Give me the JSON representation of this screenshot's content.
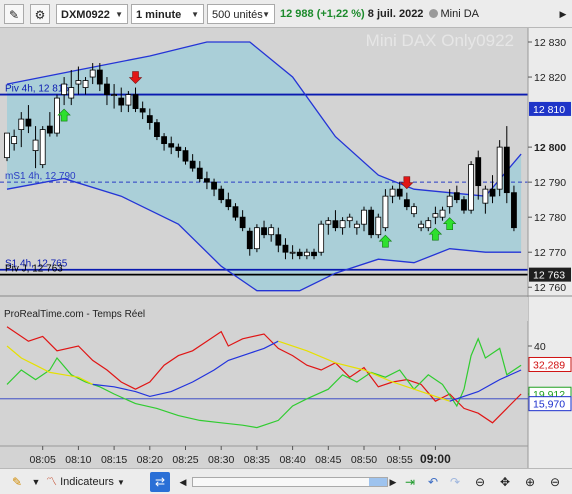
{
  "toolbar": {
    "instrument": "DXM0922",
    "timeframe": "1 minute",
    "units": "500 unités",
    "last_price": "12 988",
    "change": "(+1,22 %)",
    "date": "8 juil. 2022",
    "market_name": "Mini DA"
  },
  "chart": {
    "watermark": "Mini DAX Only0922",
    "y_ticks": [
      {
        "label": "12 830",
        "bold": false
      },
      {
        "label": "12 820",
        "bold": false
      },
      {
        "label": "12 800",
        "bold": true
      },
      {
        "label": "12 790",
        "bold": false
      },
      {
        "label": "12 780",
        "bold": false
      },
      {
        "label": "12 770",
        "bold": false
      },
      {
        "label": "12 760",
        "bold": false
      }
    ],
    "price_tags": [
      {
        "label": "12 810",
        "value": 12810.9,
        "bg": "#1f35c8",
        "fg": "#ffffff"
      },
      {
        "label": "12 763",
        "value": 12763.6,
        "bg": "#1f1f1f",
        "fg": "#ffffff"
      }
    ],
    "levels": [
      {
        "label": "Piv 4h, 12 815",
        "value": 12815,
        "color": "#0a1ab0",
        "style": "solid"
      },
      {
        "label": "mS1 4h, 12 790",
        "value": 12790,
        "color": "#2a3cc4",
        "style": "dashed"
      },
      {
        "label": "S1 4h, 12 765",
        "value": 12765,
        "color": "#0a1ab0",
        "style": "solid"
      },
      {
        "label": "Piv J, 12 763",
        "value": 12763.6,
        "color": "#000000",
        "style": "solid"
      }
    ],
    "candles": [
      [
        12797,
        12804,
        12796,
        12804
      ],
      [
        12801,
        12805,
        12799,
        12803
      ],
      [
        12805,
        12810,
        12800,
        12808
      ],
      [
        12808,
        12812,
        12804,
        12806
      ],
      [
        12799,
        12806,
        12794,
        12802
      ],
      [
        12795,
        12806,
        12794,
        12805
      ],
      [
        12806,
        12810,
        12803,
        12804
      ],
      [
        12804,
        12815,
        12803,
        12814
      ],
      [
        12815,
        12820,
        12812,
        12818
      ],
      [
        12814,
        12822,
        12812,
        12817
      ],
      [
        12818,
        12823,
        12815,
        12819
      ],
      [
        12817,
        12820,
        12815,
        12819
      ],
      [
        12820,
        12824,
        12818,
        12822
      ],
      [
        12822,
        12824,
        12816,
        12818
      ],
      [
        12818,
        12820,
        12812,
        12815
      ],
      [
        12815,
        12818,
        12811,
        12815
      ],
      [
        12814,
        12817,
        12810,
        12812
      ],
      [
        12812,
        12816,
        12810,
        12815
      ],
      [
        12815,
        12817,
        12810,
        12811
      ],
      [
        12811,
        12813,
        12808,
        12810
      ],
      [
        12809,
        12811,
        12805,
        12807
      ],
      [
        12807,
        12808,
        12802,
        12803
      ],
      [
        12803,
        12804,
        12799,
        12801
      ],
      [
        12801,
        12803,
        12798,
        12800
      ],
      [
        12800,
        12801,
        12797,
        12799
      ],
      [
        12799,
        12800,
        12795,
        12796
      ],
      [
        12796,
        12798,
        12793,
        12794
      ],
      [
        12794,
        12796,
        12790,
        12791
      ],
      [
        12791,
        12793,
        12788,
        12790
      ],
      [
        12790,
        12791,
        12786,
        12788
      ],
      [
        12788,
        12789,
        12784,
        12785
      ],
      [
        12785,
        12787,
        12782,
        12783
      ],
      [
        12783,
        12784,
        12779,
        12780
      ],
      [
        12780,
        12782,
        12776,
        12777
      ],
      [
        12776,
        12777,
        12769,
        12771
      ],
      [
        12771,
        12778,
        12770,
        12777
      ],
      [
        12777,
        12779,
        12774,
        12775
      ],
      [
        12775,
        12778,
        12773,
        12777
      ],
      [
        12775,
        12777,
        12770,
        12772
      ],
      [
        12772,
        12774,
        12768,
        12770
      ],
      [
        12770,
        12772,
        12768,
        12770
      ],
      [
        12770,
        12771,
        12768,
        12769
      ],
      [
        12769,
        12771,
        12768,
        12770
      ],
      [
        12770,
        12771,
        12768,
        12769
      ],
      [
        12770,
        12779,
        12769,
        12778
      ],
      [
        12778,
        12780,
        12775,
        12779
      ],
      [
        12779,
        12782,
        12776,
        12777
      ],
      [
        12777,
        12780,
        12775,
        12779
      ],
      [
        12779,
        12781,
        12777,
        12780
      ],
      [
        12777,
        12779,
        12775,
        12778
      ],
      [
        12778,
        12783,
        12776,
        12782
      ],
      [
        12782,
        12783,
        12774,
        12775
      ],
      [
        12775,
        12781,
        12774,
        12780
      ],
      [
        12777,
        12788,
        12776,
        12786
      ],
      [
        12786,
        12789,
        12784,
        12788
      ],
      [
        12788,
        12790,
        12785,
        12786
      ],
      [
        12785,
        12787,
        12782,
        12783
      ],
      [
        12781,
        12784,
        12780,
        12783
      ],
      [
        12777,
        12779,
        12776,
        12778
      ],
      [
        12777,
        12780,
        12776,
        12779
      ],
      [
        12780,
        12783,
        12778,
        12781
      ],
      [
        12780,
        12783,
        12779,
        12782
      ],
      [
        12783,
        12788,
        12781,
        12786
      ],
      [
        12787,
        12789,
        12784,
        12785
      ],
      [
        12785,
        12786,
        12781,
        12782
      ],
      [
        12782,
        12796,
        12781,
        12795
      ],
      [
        12797,
        12799,
        12785,
        12789
      ],
      [
        12784,
        12789,
        12781,
        12788
      ],
      [
        12788,
        12792,
        12784,
        12786
      ],
      [
        12788,
        12802,
        12786,
        12800
      ],
      [
        12800,
        12806,
        12784,
        12787
      ],
      [
        12787,
        12789,
        12776,
        12777
      ]
    ],
    "signals": [
      {
        "index": 8,
        "type": "buy"
      },
      {
        "index": 18,
        "type": "sell"
      },
      {
        "index": 53,
        "type": "buy"
      },
      {
        "index": 56,
        "type": "sell"
      },
      {
        "index": 60,
        "type": "buy"
      },
      {
        "index": 62,
        "type": "buy"
      }
    ],
    "bollinger": {
      "upper": [
        [
          0,
          12818
        ],
        [
          10,
          12822
        ],
        [
          20,
          12826
        ],
        [
          28,
          12830
        ],
        [
          34,
          12830
        ],
        [
          40,
          12820
        ],
        [
          46,
          12803
        ],
        [
          52,
          12792
        ],
        [
          57,
          12788
        ],
        [
          62,
          12787
        ],
        [
          67,
          12786
        ],
        [
          72,
          12798
        ]
      ],
      "lower": [
        [
          0,
          12788
        ],
        [
          8,
          12791
        ],
        [
          16,
          12786
        ],
        [
          24,
          12778
        ],
        [
          30,
          12766
        ],
        [
          35,
          12759
        ],
        [
          41,
          12759
        ],
        [
          46,
          12764
        ],
        [
          52,
          12768
        ],
        [
          57,
          12767
        ],
        [
          62,
          12771
        ],
        [
          67,
          12770
        ],
        [
          72,
          12770
        ]
      ]
    },
    "x_ticks": [
      {
        "index": 5,
        "label": "08:05",
        "bold": false
      },
      {
        "index": 10,
        "label": "08:10",
        "bold": false
      },
      {
        "index": 15,
        "label": "08:15",
        "bold": false
      },
      {
        "index": 20,
        "label": "08:20",
        "bold": false
      },
      {
        "index": 25,
        "label": "08:25",
        "bold": false
      },
      {
        "index": 30,
        "label": "08:30",
        "bold": false
      },
      {
        "index": 35,
        "label": "08:35",
        "bold": false
      },
      {
        "index": 40,
        "label": "08:40",
        "bold": false
      },
      {
        "index": 45,
        "label": "08:45",
        "bold": false
      },
      {
        "index": 50,
        "label": "08:50",
        "bold": false
      },
      {
        "index": 55,
        "label": "08:55",
        "bold": false
      },
      {
        "index": 60,
        "label": "09:00",
        "bold": true
      }
    ]
  },
  "indicator": {
    "source_label": "ProRealTime.com - Temps Réel",
    "y_ticks": [
      {
        "label": "40",
        "value": 40
      },
      {
        "label": "20",
        "value": 20
      }
    ],
    "ylim": [
      0,
      50
    ],
    "ref_line": 18,
    "value_tags": [
      {
        "label": "32,289",
        "value": 32.3,
        "bg": "#ffffff",
        "fg": "#d01010",
        "border": "#d01010"
      },
      {
        "label": "19,912",
        "value": 19.9,
        "bg": "#ffffff",
        "fg": "#20a020",
        "border": "#20a020"
      },
      {
        "label": "15,970",
        "value": 15.97,
        "bg": "#ffffff",
        "fg": "#1a2ecc",
        "border": "#1a2ecc"
      }
    ],
    "series": [
      {
        "color": "#e01515",
        "points": [
          [
            0,
            48
          ],
          [
            3,
            42
          ],
          [
            5,
            44
          ],
          [
            7,
            38
          ],
          [
            10,
            40
          ],
          [
            12,
            34
          ],
          [
            14,
            30
          ],
          [
            16,
            25
          ],
          [
            18,
            22
          ],
          [
            20,
            25
          ],
          [
            22,
            32
          ],
          [
            24,
            36
          ],
          [
            26,
            38
          ],
          [
            28,
            42
          ],
          [
            30,
            46
          ],
          [
            31,
            40
          ],
          [
            33,
            43
          ],
          [
            36,
            45
          ],
          [
            38,
            39
          ],
          [
            40,
            36
          ],
          [
            42,
            32
          ],
          [
            44,
            30
          ],
          [
            46,
            33
          ],
          [
            48,
            27
          ],
          [
            50,
            31
          ],
          [
            52,
            23
          ],
          [
            54,
            25
          ],
          [
            56,
            26
          ],
          [
            58,
            24
          ],
          [
            60,
            17
          ],
          [
            62,
            20
          ],
          [
            64,
            14
          ],
          [
            66,
            12
          ],
          [
            68,
            8
          ],
          [
            70,
            14
          ],
          [
            72,
            20
          ]
        ]
      },
      {
        "color": "#30cc30",
        "points": [
          [
            0,
            24
          ],
          [
            2,
            30
          ],
          [
            4,
            26
          ],
          [
            6,
            30
          ],
          [
            7,
            35
          ],
          [
            9,
            28
          ],
          [
            11,
            25
          ],
          [
            13,
            23
          ],
          [
            15,
            20
          ],
          [
            18,
            16
          ],
          [
            21,
            14
          ],
          [
            24,
            11
          ],
          [
            27,
            9
          ],
          [
            30,
            8
          ],
          [
            33,
            7
          ],
          [
            35,
            6
          ],
          [
            38,
            9
          ],
          [
            40,
            15
          ],
          [
            42,
            18
          ],
          [
            45,
            22
          ],
          [
            47,
            28
          ],
          [
            49,
            25
          ],
          [
            51,
            29
          ],
          [
            53,
            27
          ],
          [
            55,
            30
          ],
          [
            57,
            22
          ],
          [
            59,
            28
          ],
          [
            61,
            24
          ],
          [
            63,
            15
          ],
          [
            64,
            22
          ],
          [
            65,
            36
          ],
          [
            66,
            43
          ],
          [
            67,
            35
          ],
          [
            69,
            39
          ],
          [
            70,
            28
          ],
          [
            72,
            32
          ]
        ]
      },
      {
        "color": "#e6e000",
        "points": [
          [
            0,
            40
          ],
          [
            2,
            35
          ],
          [
            4,
            32
          ],
          [
            6,
            29
          ],
          [
            8,
            28
          ],
          [
            10,
            27
          ],
          [
            12,
            24
          ]
        ]
      },
      {
        "color": "#2233dd",
        "points": [
          [
            12,
            24
          ],
          [
            15,
            23
          ],
          [
            18,
            21
          ],
          [
            20,
            19
          ],
          [
            23,
            21
          ],
          [
            26,
            25
          ],
          [
            29,
            30
          ],
          [
            31,
            34
          ],
          [
            34,
            37
          ],
          [
            36,
            39
          ],
          [
            38,
            42
          ]
        ]
      },
      {
        "color": "#e6e000",
        "points": [
          [
            38,
            42
          ],
          [
            42,
            38
          ],
          [
            46,
            33
          ],
          [
            50,
            30
          ],
          [
            54,
            25
          ],
          [
            58,
            21
          ],
          [
            62,
            17
          ]
        ]
      },
      {
        "color": "#2233dd",
        "points": [
          [
            62,
            17
          ],
          [
            66,
            21
          ],
          [
            69,
            26
          ],
          [
            72,
            30
          ]
        ]
      }
    ]
  },
  "statusbar": {
    "indicators_label": "Indicateurs"
  }
}
